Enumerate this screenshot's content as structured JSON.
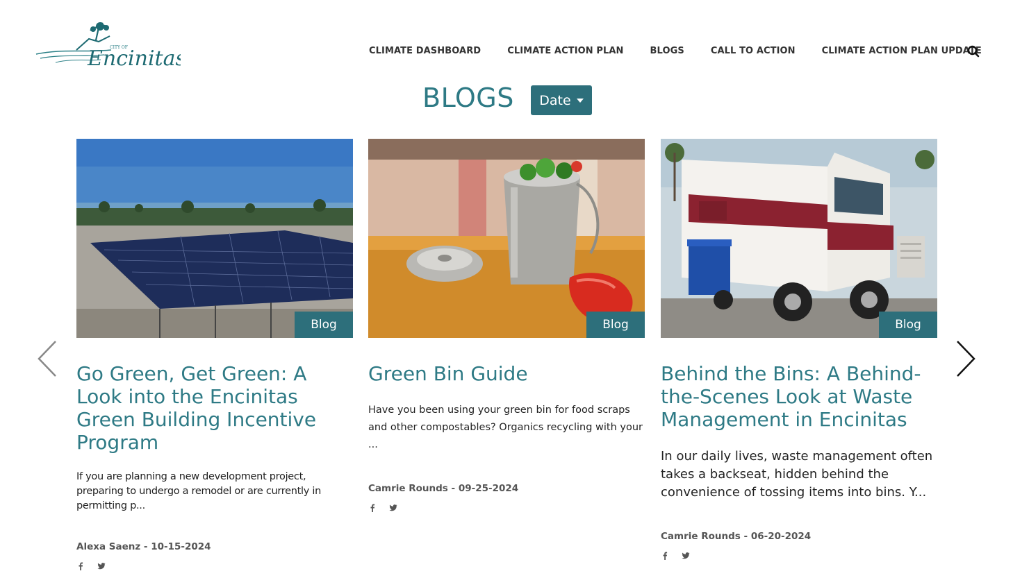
{
  "header": {
    "logo_small_text": "CITY OF",
    "logo_name": "Encinitas",
    "nav": [
      {
        "label": "CLIMATE DASHBOARD"
      },
      {
        "label": "CLIMATE ACTION PLAN"
      },
      {
        "label": "BLOGS"
      },
      {
        "label": "CALL TO ACTION"
      },
      {
        "label": "CLIMATE ACTION PLAN UPDATE"
      }
    ],
    "search_icon": "search-icon"
  },
  "page": {
    "title": "BLOGS",
    "sort_button_label": "Date"
  },
  "cards": [
    {
      "badge": "Blog",
      "title": "Go Green, Get Green: A Look into the Encinitas Green Building Incentive Program",
      "excerpt": "If you are planning a new development project, preparing to undergo a remodel or are currently in permitting p...",
      "meta": "Alexa Saenz - 10-15-2024",
      "image": "solar-panels-rooftop"
    },
    {
      "badge": "Blog",
      "title": "Green Bin Guide",
      "excerpt": "Have you been using your green bin for food scraps and other compostables?  Organics recycling with your ...",
      "meta": "Camrie Rounds - 09-25-2024",
      "image": "compost-pail"
    },
    {
      "badge": "Blog",
      "title": "Behind the Bins: A Behind-the-Scenes Look at Waste Management in Encinitas",
      "excerpt": "In our daily lives, waste management often takes a backseat, hidden behind the convenience of tossing items into bins. Y...",
      "meta": "Camrie Rounds - 06-20-2024",
      "image": "waste-truck"
    }
  ],
  "colors": {
    "accent": "#2e7a85",
    "button": "#2d6f7b"
  }
}
